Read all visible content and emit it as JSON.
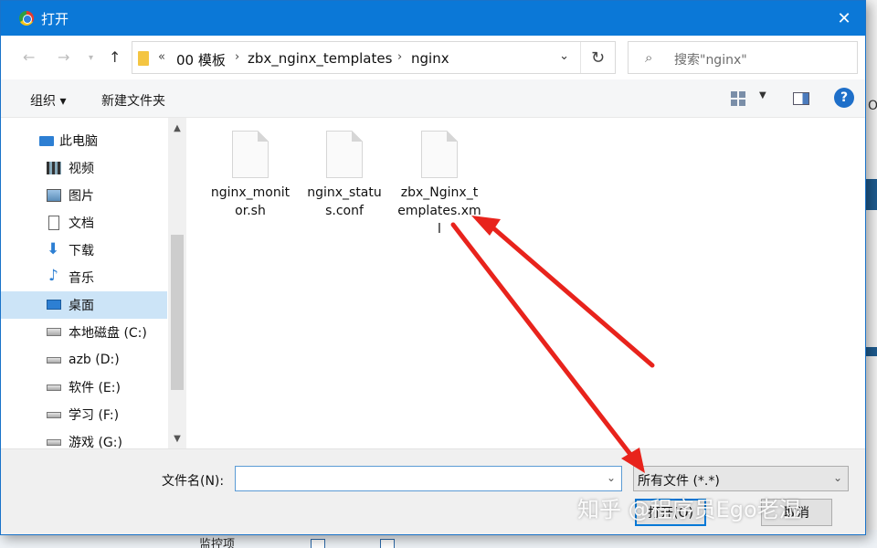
{
  "window": {
    "title": "打开"
  },
  "address": {
    "overflow": "«",
    "crumbs": [
      "00 模板",
      "zbx_nginx_templates",
      "nginx"
    ]
  },
  "search": {
    "placeholder": "搜索\"nginx\""
  },
  "toolbar": {
    "organize": "组织 ▾",
    "new_folder": "新建文件夹",
    "help": "?"
  },
  "nav": {
    "items": [
      {
        "label": "此电脑",
        "icon": "computer-icon"
      },
      {
        "label": "视频",
        "icon": "video-icon"
      },
      {
        "label": "图片",
        "icon": "pictures-icon"
      },
      {
        "label": "文档",
        "icon": "documents-icon"
      },
      {
        "label": "下载",
        "icon": "download-icon"
      },
      {
        "label": "音乐",
        "icon": "music-icon"
      },
      {
        "label": "桌面",
        "icon": "desktop-icon"
      },
      {
        "label": "本地磁盘 (C:)",
        "icon": "drive-icon"
      },
      {
        "label": "azb (D:)",
        "icon": "drive-icon"
      },
      {
        "label": "软件 (E:)",
        "icon": "drive-icon"
      },
      {
        "label": "学习 (F:)",
        "icon": "drive-icon"
      },
      {
        "label": "游戏 (G:)",
        "icon": "drive-icon"
      }
    ],
    "selected": "桌面"
  },
  "files": [
    {
      "name": "nginx_monitor.sh",
      "icon": "file-icon"
    },
    {
      "name": "nginx_status.conf",
      "icon": "file-icon"
    },
    {
      "name": "zbx_Nginx_templates.xml",
      "icon": "file-icon"
    }
  ],
  "bottom": {
    "filename_label": "文件名(N):",
    "filename_value": "",
    "filetype_value": "所有文件 (*.*)",
    "open_label": "打开(O)",
    "cancel_label": "取消"
  },
  "background": {
    "checkbox_label": "监控项"
  },
  "watermark": "知乎 @程序员Ego老湿",
  "colors": {
    "titlebar": "#0b78d7",
    "selection": "#cce4f7",
    "annotation_arrow": "#e8231c"
  }
}
